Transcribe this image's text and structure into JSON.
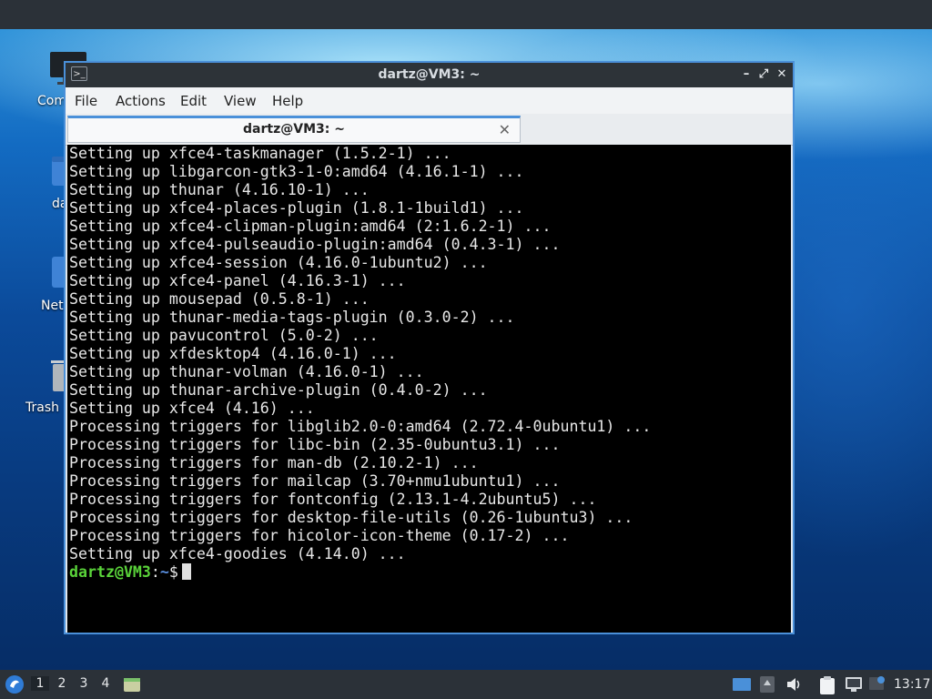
{
  "desktop": {
    "icons": [
      {
        "label": "Com",
        "icon": "computer-icon"
      },
      {
        "label": "da",
        "icon": "folder-icon"
      },
      {
        "label": "Net",
        "icon": "network-icon"
      },
      {
        "label": "Trash",
        "icon": "trash-icon"
      }
    ]
  },
  "window": {
    "title": "dartz@VM3: ~",
    "icon": "terminal-icon",
    "controls": {
      "minimize": "–",
      "maximize": "⤢",
      "close": "✕"
    }
  },
  "menu": [
    "File",
    "Actions",
    "Edit",
    "View",
    "Help"
  ],
  "tab": {
    "title": "dartz@VM3: ~",
    "close": "✕"
  },
  "terminal": {
    "lines": [
      "Setting up xfce4-taskmanager (1.5.2-1) ...",
      "Setting up libgarcon-gtk3-1-0:amd64 (4.16.1-1) ...",
      "Setting up thunar (4.16.10-1) ...",
      "Setting up xfce4-places-plugin (1.8.1-1build1) ...",
      "Setting up xfce4-clipman-plugin:amd64 (2:1.6.2-1) ...",
      "Setting up xfce4-pulseaudio-plugin:amd64 (0.4.3-1) ...",
      "Setting up xfce4-session (4.16.0-1ubuntu2) ...",
      "Setting up xfce4-panel (4.16.3-1) ...",
      "Setting up mousepad (0.5.8-1) ...",
      "Setting up thunar-media-tags-plugin (0.3.0-2) ...",
      "Setting up pavucontrol (5.0-2) ...",
      "Setting up xfdesktop4 (4.16.0-1) ...",
      "Setting up thunar-volman (4.16.0-1) ...",
      "Setting up thunar-archive-plugin (0.4.0-2) ...",
      "Setting up xfce4 (4.16) ...",
      "Processing triggers for libglib2.0-0:amd64 (2.72.4-0ubuntu1) ...",
      "Processing triggers for libc-bin (2.35-0ubuntu3.1) ...",
      "Processing triggers for man-db (2.10.2-1) ...",
      "Processing triggers for mailcap (3.70+nmu1ubuntu1) ...",
      "Processing triggers for fontconfig (2.13.1-4.2ubuntu5) ...",
      "Processing triggers for desktop-file-utils (0.26-1ubuntu3) ...",
      "Processing triggers for hicolor-icon-theme (0.17-2) ...",
      "Setting up xfce4-goodies (4.14.0) ..."
    ],
    "prompt": {
      "user_host": "dartz@VM3",
      "sep": ":",
      "path": "~",
      "symbol": "$"
    }
  },
  "taskbar": {
    "workspaces": [
      "1",
      "2",
      "3",
      "4"
    ],
    "active_workspace": "1",
    "clock": "13:17",
    "accent": "#4a90d9"
  }
}
